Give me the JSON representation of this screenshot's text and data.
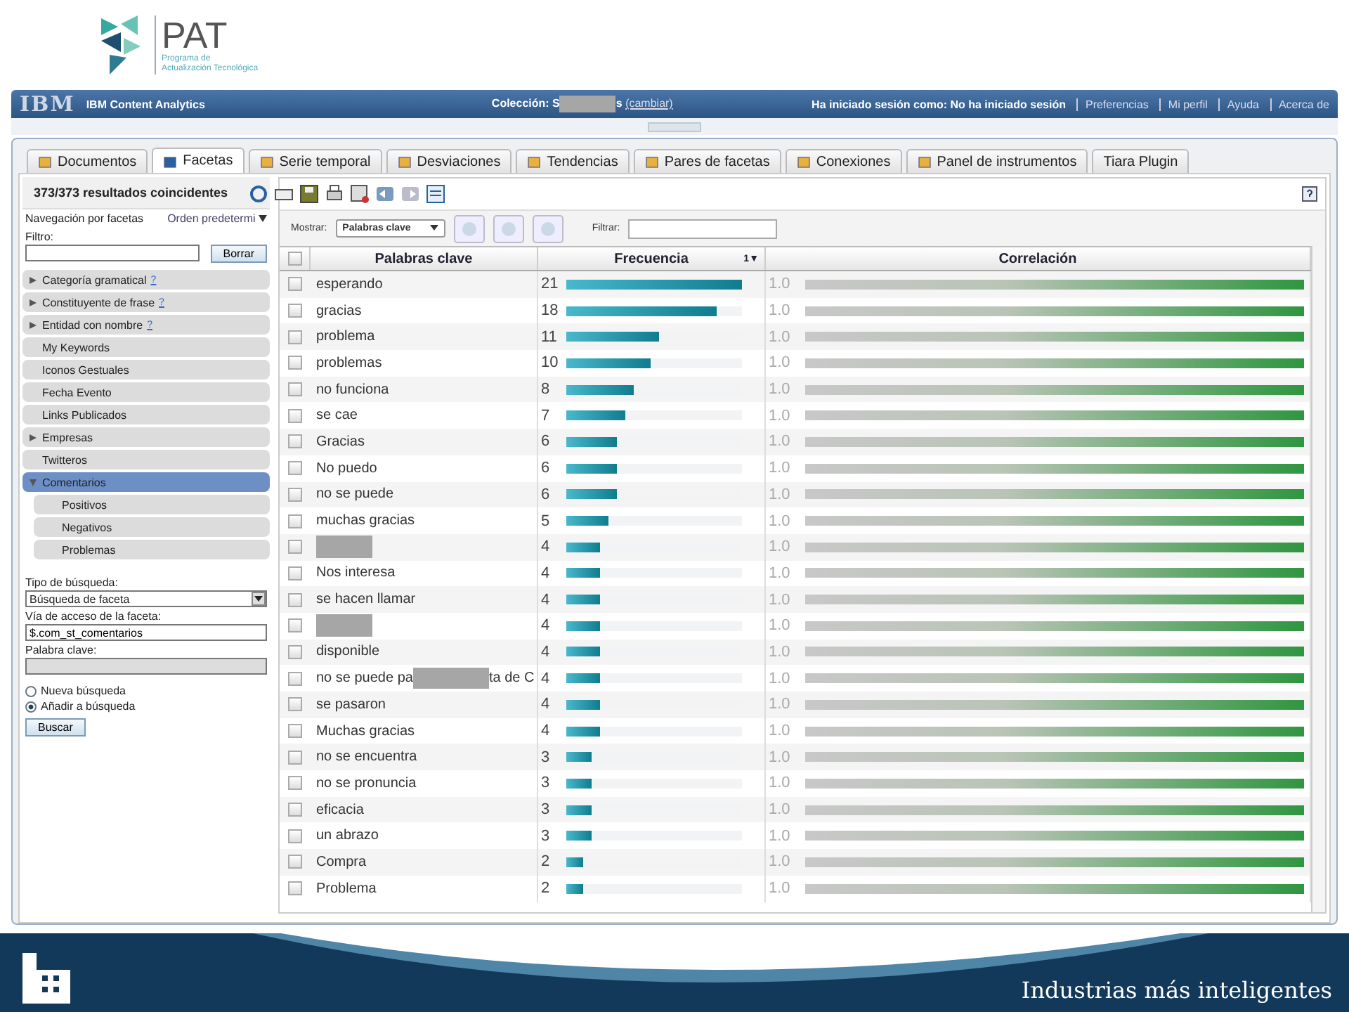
{
  "logo": {
    "name": "PAT",
    "subtitle_1": "Programa de",
    "subtitle_2": "Actualización Tecnológica"
  },
  "topbar": {
    "brand": "IBM",
    "product": "IBM Content Analytics",
    "collection_before": "Colección: S",
    "collection_after": "s",
    "change_link": "(cambiar)",
    "session": "Ha iniciado sesión como: No ha iniciado sesión",
    "links": [
      "Preferencias",
      "Mi perfil",
      "Ayuda",
      "Acerca de"
    ]
  },
  "tabs": [
    {
      "label": "Documentos",
      "selected": false
    },
    {
      "label": "Facetas",
      "selected": true
    },
    {
      "label": "Serie temporal",
      "selected": false
    },
    {
      "label": "Desviaciones",
      "selected": false
    },
    {
      "label": "Tendencias",
      "selected": false
    },
    {
      "label": "Pares de facetas",
      "selected": false
    },
    {
      "label": "Conexiones",
      "selected": false
    },
    {
      "label": "Panel de instrumentos",
      "selected": false
    },
    {
      "label": "Tiara Plugin",
      "selected": false
    }
  ],
  "sidebar": {
    "results": "373/373 resultados coincidentes",
    "nav_label": "Navegación por facetas",
    "order": "Orden predetermi",
    "filter_label": "Filtro:",
    "clear_button": "Borrar",
    "facets": [
      {
        "label": "Categoría gramatical",
        "help": "?",
        "kind": "group",
        "expanded": false,
        "selected": false
      },
      {
        "label": "Constituyente de frase",
        "help": "?",
        "kind": "group",
        "expanded": false,
        "selected": false
      },
      {
        "label": "Entidad con nombre",
        "help": "?",
        "kind": "group",
        "expanded": false,
        "selected": false
      },
      {
        "label": "My Keywords",
        "kind": "leaf",
        "selected": false
      },
      {
        "label": "Iconos Gestuales",
        "kind": "leaf",
        "selected": false
      },
      {
        "label": "Fecha Evento",
        "kind": "leaf",
        "selected": false
      },
      {
        "label": "Links Publicados",
        "kind": "leaf",
        "selected": false
      },
      {
        "label": "Empresas",
        "kind": "group",
        "expanded": false,
        "selected": false
      },
      {
        "label": "Twitteros",
        "kind": "leaf",
        "selected": false
      },
      {
        "label": "Comentarios",
        "kind": "group",
        "expanded": true,
        "selected": true,
        "children": [
          {
            "label": "Positivos"
          },
          {
            "label": "Negativos"
          },
          {
            "label": "Problemas"
          }
        ]
      }
    ],
    "search_type_label": "Tipo de búsqueda:",
    "search_type": "Búsqueda de faceta",
    "path_label": "Vía de acceso de la faceta:",
    "path_value": "$.com_st_comentarios",
    "keyword_label": "Palabra clave:",
    "radios": [
      {
        "label": "Nueva búsqueda",
        "selected": false
      },
      {
        "label": "Añadir a búsqueda",
        "selected": true
      }
    ],
    "search_button": "Buscar"
  },
  "toolbar": {
    "show_label": "Mostrar:",
    "show_value": "Palabras clave",
    "filter_label": "Filtrar:"
  },
  "table": {
    "columns": [
      "Palabras clave",
      "Frecuencia",
      "Correlación"
    ],
    "sort_indicator": "1▼",
    "all_checked": false,
    "rows": [
      {
        "keyword": "esperando",
        "redacted": false,
        "checked": false,
        "freq": "21",
        "level": 1,
        "corr": "1.0"
      },
      {
        "keyword": "gracias",
        "redacted": false,
        "checked": false,
        "freq": "18",
        "level": 0.857,
        "corr": "1.0"
      },
      {
        "keyword": "problema",
        "redacted": false,
        "checked": false,
        "freq": "11",
        "level": 0.524,
        "corr": "1.0"
      },
      {
        "keyword": "problemas",
        "redacted": false,
        "checked": false,
        "freq": "10",
        "level": 0.476,
        "corr": "1.0"
      },
      {
        "keyword": "no funciona",
        "redacted": false,
        "checked": false,
        "freq": "8",
        "level": 0.381,
        "corr": "1.0"
      },
      {
        "keyword": "se cae",
        "redacted": false,
        "checked": false,
        "freq": "7",
        "level": 0.333,
        "corr": "1.0"
      },
      {
        "keyword": "Gracias",
        "redacted": false,
        "checked": false,
        "freq": "6",
        "level": 0.286,
        "corr": "1.0"
      },
      {
        "keyword": "No puedo",
        "redacted": false,
        "checked": false,
        "freq": "6",
        "level": 0.286,
        "corr": "1.0"
      },
      {
        "keyword": "no se puede",
        "redacted": false,
        "checked": false,
        "freq": "6",
        "level": 0.286,
        "corr": "1.0"
      },
      {
        "keyword": "muchas gracias",
        "redacted": false,
        "checked": false,
        "freq": "5",
        "level": 0.238,
        "corr": "1.0"
      },
      {
        "redacted": true,
        "checked": false,
        "freq": "4",
        "level": 0.19,
        "corr": "1.0"
      },
      {
        "keyword": "Nos interesa",
        "redacted": false,
        "checked": false,
        "freq": "4",
        "level": 0.19,
        "corr": "1.0"
      },
      {
        "keyword": "se hacen llamar",
        "redacted": false,
        "checked": false,
        "freq": "4",
        "level": 0.19,
        "corr": "1.0"
      },
      {
        "redacted": true,
        "checked": false,
        "freq": "4",
        "level": 0.19,
        "corr": "1.0"
      },
      {
        "keyword": "disponible",
        "redacted": false,
        "checked": false,
        "freq": "4",
        "level": 0.19,
        "corr": "1.0"
      },
      {
        "keyword": "no se puede pa",
        "keyword_after": "ta de C",
        "redacted": true,
        "checked": false,
        "freq": "4",
        "level": 0.19,
        "corr": "1.0"
      },
      {
        "keyword": "se pasaron",
        "redacted": false,
        "checked": false,
        "freq": "4",
        "level": 0.19,
        "corr": "1.0"
      },
      {
        "keyword": "Muchas gracias",
        "redacted": false,
        "checked": false,
        "freq": "4",
        "level": 0.19,
        "corr": "1.0"
      },
      {
        "keyword": "no se encuentra",
        "redacted": false,
        "checked": false,
        "freq": "3",
        "level": 0.143,
        "corr": "1.0"
      },
      {
        "keyword": "no se pronuncia",
        "redacted": false,
        "checked": false,
        "freq": "3",
        "level": 0.143,
        "corr": "1.0"
      },
      {
        "keyword": "eficacia",
        "redacted": false,
        "checked": false,
        "freq": "3",
        "level": 0.143,
        "corr": "1.0"
      },
      {
        "keyword": "un abrazo",
        "redacted": false,
        "checked": false,
        "freq": "3",
        "level": 0.143,
        "corr": "1.0"
      },
      {
        "keyword": "Compra",
        "redacted": false,
        "checked": false,
        "freq": "2",
        "level": 0.095,
        "corr": "1.0"
      },
      {
        "keyword": "Problema",
        "redacted": false,
        "checked": false,
        "freq": "2",
        "level": 0.095,
        "corr": "1.0"
      }
    ]
  },
  "footer": {
    "slogan": "Industrias más inteligentes"
  }
}
